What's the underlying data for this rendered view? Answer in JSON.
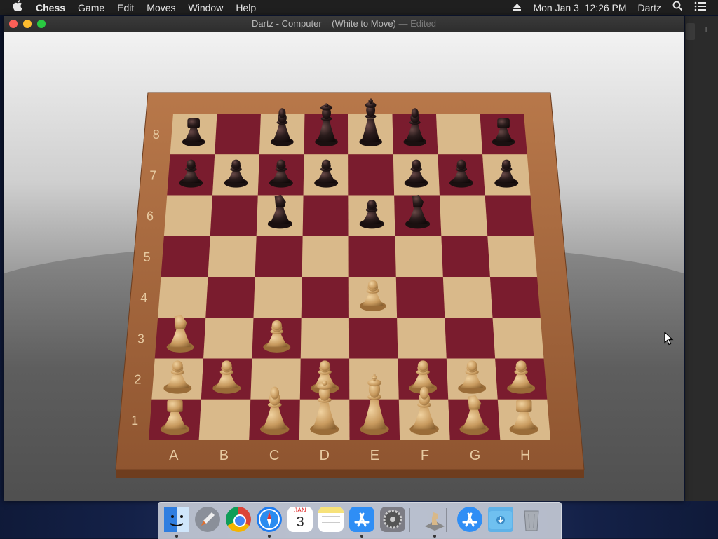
{
  "menubar": {
    "apple_icon": "apple-icon",
    "app_name": "Chess",
    "items": [
      "Game",
      "Edit",
      "Moves",
      "Window",
      "Help"
    ],
    "clock": "Mon Jan 3  12:26 PM",
    "user": "Dartz",
    "right_icons": [
      "eject-icon",
      "search-icon",
      "control-center-icon"
    ]
  },
  "window": {
    "title": "Dartz - Computer    (White to Move)",
    "edited": " — Edited"
  },
  "board": {
    "files": [
      "A",
      "B",
      "C",
      "D",
      "E",
      "F",
      "G",
      "H"
    ],
    "ranks": [
      "8",
      "7",
      "6",
      "5",
      "4",
      "3",
      "2",
      "1"
    ],
    "light_square": "#d9b98a",
    "dark_square": "#7a1c2e",
    "frame_color": "#a8683a",
    "white_piece_color": "#c89a5e",
    "black_piece_color": "#2a1c1c",
    "pieces": [
      {
        "square": "a8",
        "type": "rook",
        "color": "black"
      },
      {
        "square": "c8",
        "type": "bishop",
        "color": "black"
      },
      {
        "square": "d8",
        "type": "queen",
        "color": "black"
      },
      {
        "square": "e8",
        "type": "king",
        "color": "black"
      },
      {
        "square": "f8",
        "type": "bishop",
        "color": "black"
      },
      {
        "square": "h8",
        "type": "rook",
        "color": "black"
      },
      {
        "square": "a7",
        "type": "pawn",
        "color": "black"
      },
      {
        "square": "b7",
        "type": "pawn",
        "color": "black"
      },
      {
        "square": "c7",
        "type": "pawn",
        "color": "black"
      },
      {
        "square": "d7",
        "type": "pawn",
        "color": "black"
      },
      {
        "square": "f7",
        "type": "pawn",
        "color": "black"
      },
      {
        "square": "g7",
        "type": "pawn",
        "color": "black"
      },
      {
        "square": "h7",
        "type": "pawn",
        "color": "black"
      },
      {
        "square": "c6",
        "type": "knight",
        "color": "black"
      },
      {
        "square": "e6",
        "type": "pawn",
        "color": "black"
      },
      {
        "square": "f6",
        "type": "knight",
        "color": "black"
      },
      {
        "square": "e4",
        "type": "pawn",
        "color": "white"
      },
      {
        "square": "a3",
        "type": "knight",
        "color": "white"
      },
      {
        "square": "c3",
        "type": "pawn",
        "color": "white"
      },
      {
        "square": "a2",
        "type": "pawn",
        "color": "white"
      },
      {
        "square": "b2",
        "type": "pawn",
        "color": "white"
      },
      {
        "square": "d2",
        "type": "pawn",
        "color": "white"
      },
      {
        "square": "f2",
        "type": "pawn",
        "color": "white"
      },
      {
        "square": "g2",
        "type": "pawn",
        "color": "white"
      },
      {
        "square": "h2",
        "type": "pawn",
        "color": "white"
      },
      {
        "square": "a1",
        "type": "rook",
        "color": "white"
      },
      {
        "square": "c1",
        "type": "bishop",
        "color": "white"
      },
      {
        "square": "d1",
        "type": "queen",
        "color": "white"
      },
      {
        "square": "e1",
        "type": "king",
        "color": "white"
      },
      {
        "square": "f1",
        "type": "bishop",
        "color": "white"
      },
      {
        "square": "g1",
        "type": "knight",
        "color": "white"
      },
      {
        "square": "h1",
        "type": "rook",
        "color": "white"
      }
    ]
  },
  "dock": {
    "items": [
      {
        "name": "finder-icon",
        "color": "#3d8ee8",
        "running": true
      },
      {
        "name": "launchpad-icon",
        "color": "#8a8f99",
        "running": false
      },
      {
        "name": "chrome-icon",
        "color": "#ffffff",
        "running": false
      },
      {
        "name": "safari-icon",
        "color": "#1e7cf0",
        "running": true
      },
      {
        "name": "calendar-icon",
        "color": "#ffffff",
        "running": false,
        "label_month": "JAN",
        "label_day": "3"
      },
      {
        "name": "notes-icon",
        "color": "#f7e27a",
        "running": false
      },
      {
        "name": "app-store-icon",
        "color": "#2f8ef5",
        "running": true
      },
      {
        "name": "system-preferences-icon",
        "color": "#7d7d85",
        "running": false
      },
      {
        "name": "chess-icon",
        "color": "#c9c9c9",
        "running": true
      },
      {
        "name": "app-store-downloads-icon",
        "color": "#2f8ef5",
        "running": false
      },
      {
        "name": "downloads-folder-icon",
        "color": "#5fb2e8",
        "running": false
      },
      {
        "name": "trash-icon",
        "color": "#9aa0a8",
        "running": false
      }
    ]
  }
}
